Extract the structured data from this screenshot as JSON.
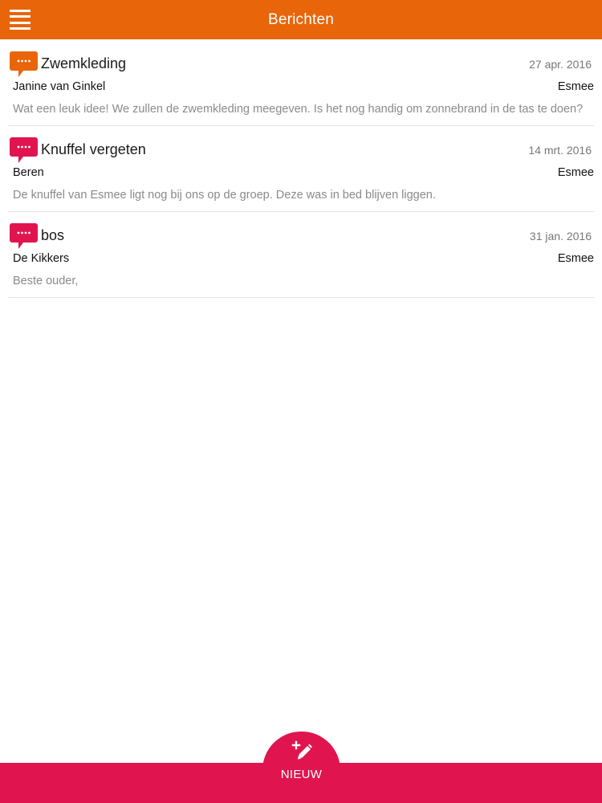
{
  "header": {
    "title": "Berichten",
    "menu_icon": "hamburger-menu-icon",
    "color": "#e8650a"
  },
  "messages": [
    {
      "subject": "Zwemkleding",
      "date": "27 apr. 2016",
      "sender": "Janine van Ginkel",
      "child": "Esmee",
      "preview": "Wat een leuk idee! We zullen de zwemkleding meegeven. Is het nog handig om zonnebrand in de tas te doen?",
      "icon": "chat-bubble-icon",
      "icon_color": "#e8650a"
    },
    {
      "subject": "Knuffel vergeten",
      "date": "14 mrt. 2016",
      "sender": "Beren",
      "child": "Esmee",
      "preview": "De knuffel van Esmee ligt nog bij ons op de groep. Deze was in bed blijven liggen.",
      "icon": "chat-bubble-icon",
      "icon_color": "#e0154f"
    },
    {
      "subject": "bos",
      "date": "31 jan. 2016",
      "sender": "De Kikkers",
      "child": "Esmee",
      "preview": "Beste ouder,",
      "icon": "chat-bubble-icon",
      "icon_color": "#e0154f"
    }
  ],
  "footer": {
    "new_label": "NIEUW",
    "new_icon": "pencil-plus-icon",
    "color": "#e0154f"
  }
}
